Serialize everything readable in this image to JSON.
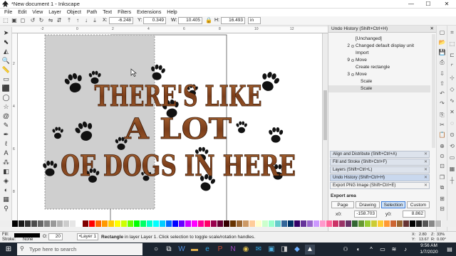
{
  "window": {
    "title": "*New document 1 - Inkscape",
    "buttons": {
      "minimize": "—",
      "maximize": "☐",
      "close": "✕"
    }
  },
  "menu": [
    "File",
    "Edit",
    "View",
    "Layer",
    "Object",
    "Path",
    "Text",
    "Filters",
    "Extensions",
    "Help"
  ],
  "toolctl": {
    "x_label": "X:",
    "x_value": "-6.248",
    "y_label": "Y:",
    "y_value": "0.349",
    "w_label": "W:",
    "w_value": "10.405",
    "h_label": "H:",
    "h_value": "16.493",
    "units": "in"
  },
  "rulers": {
    "top": [
      "-2",
      "0",
      "2",
      "4",
      "6",
      "8",
      "10",
      "12"
    ],
    "left": [
      "2",
      "4",
      "6",
      "8"
    ]
  },
  "canvas": {
    "artwork_lines": [
      "THERE'S LIKE",
      "A LOT",
      "OF DOGS IN HERE"
    ]
  },
  "dock": {
    "undo_header": "Undo History (Shift+Ctrl+H)",
    "history": [
      {
        "num": "",
        "label": "[Unchanged]",
        "indent": false,
        "sel": false
      },
      {
        "num": "2",
        "label": "Changed default display unit",
        "indent": false,
        "sel": false
      },
      {
        "num": "",
        "label": "Import",
        "indent": false,
        "sel": false
      },
      {
        "num": "9",
        "label": "Move",
        "indent": false,
        "sel": false
      },
      {
        "num": "",
        "label": "Create rectangle",
        "indent": false,
        "sel": false
      },
      {
        "num": "3",
        "label": "Move",
        "indent": false,
        "sel": false
      },
      {
        "num": "",
        "label": "Scale",
        "indent": true,
        "sel": false
      },
      {
        "num": "",
        "label": "Scale",
        "indent": true,
        "sel": true
      }
    ],
    "bars": [
      "Align and Distribute (Shift+Ctrl+A)",
      "Fill and Stroke (Shift+Ctrl+F)",
      "Layers (Shift+Ctrl+L)",
      "Undo History (Shift+Ctrl+H)",
      "Export PNG Image (Shift+Ctrl+E)"
    ],
    "export_area": "Export area",
    "export_tabs": [
      "Page",
      "Drawing",
      "Selection",
      "Custom"
    ],
    "x0_label": "x0:",
    "x0_value": "-158.703",
    "y0_label": "y0:",
    "y0_value": "8.862"
  },
  "status": {
    "fill_label": "Fill:",
    "stroke_label": "Stroke:",
    "stroke_value": "None",
    "opacity_label": "O:",
    "opacity_value": "20",
    "layer_value": "•Layer 1",
    "message_bold": "Rectangle",
    "message": " in layer Layer 1. Click selection to toggle scale/rotation handles.",
    "x_label": "X:",
    "x_value": "2.80",
    "y_label": "Y:",
    "y_value": "13.67",
    "z_label": "Z:",
    "z_value": "33%",
    "r_label": "R:",
    "r_value": "0.00°"
  },
  "taskbar": {
    "search_placeholder": "Type here to search",
    "time": "9:56 AM",
    "date": "1/7/2020"
  },
  "colors": {
    "wood": "#7a3d1a",
    "wood_light": "#b06a35",
    "selection_gray": "#cfcfcf",
    "taskbar": "#1c2530"
  }
}
